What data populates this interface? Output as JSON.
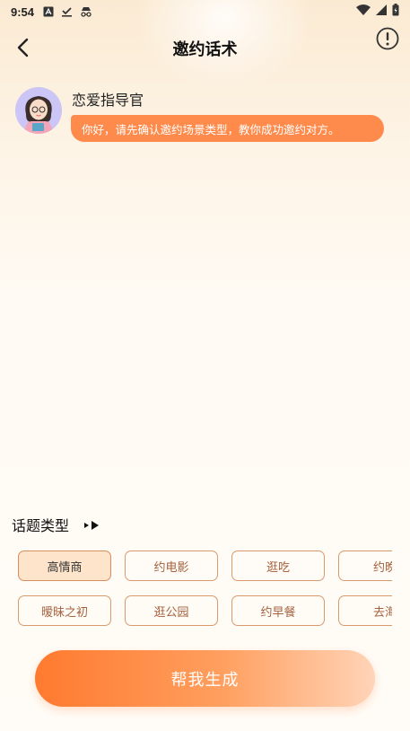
{
  "status_bar": {
    "time": "9:54"
  },
  "header": {
    "title": "邀约话术"
  },
  "chat": {
    "bot_name": "恋爱指导官",
    "message": "你好，请先确认邀约场景类型，教你成功邀约对方。"
  },
  "topic": {
    "label": "话题类型",
    "chips": [
      {
        "label": "高情商",
        "selected": true
      },
      {
        "label": "约电影",
        "selected": false
      },
      {
        "label": "逛吃",
        "selected": false
      },
      {
        "label": "约晚",
        "selected": false
      },
      {
        "label": "暧昧之初",
        "selected": false
      },
      {
        "label": "逛公园",
        "selected": false
      },
      {
        "label": "约早餐",
        "selected": false
      },
      {
        "label": "去海",
        "selected": false
      }
    ]
  },
  "cta": {
    "label": "帮我生成"
  },
  "colors": {
    "accent": "#fe8b4c",
    "chip_border": "#d99a6e",
    "chip_selected_bg": "#fde4cb"
  }
}
